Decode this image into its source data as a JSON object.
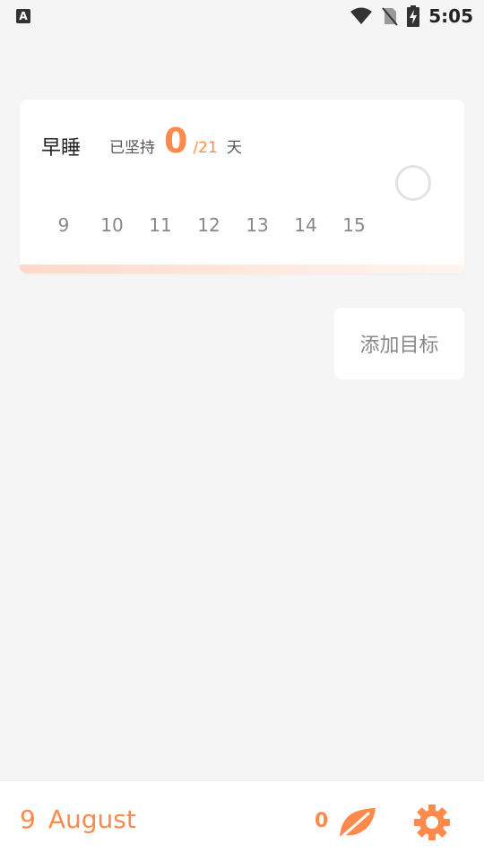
{
  "status_bar": {
    "notification_icon": "a-notification-icon",
    "notification_label": "A",
    "time": "5:05",
    "icons": [
      "wifi-icon",
      "no-sim-icon",
      "battery-charging-icon"
    ]
  },
  "goal_card": {
    "title": "早睡",
    "persist_label": "已坚持",
    "days_done": "0",
    "days_target": "/21",
    "unit": "天",
    "days": [
      "9",
      "10",
      "11",
      "12",
      "13",
      "14",
      "15"
    ],
    "progress": 0
  },
  "add_goal": {
    "label": "添加目标"
  },
  "bottom_bar": {
    "day": "9",
    "month": "August",
    "leaf_count": "0"
  },
  "colors": {
    "accent": "#ff8a4c",
    "background": "#f5f5f5",
    "card": "#ffffff"
  }
}
